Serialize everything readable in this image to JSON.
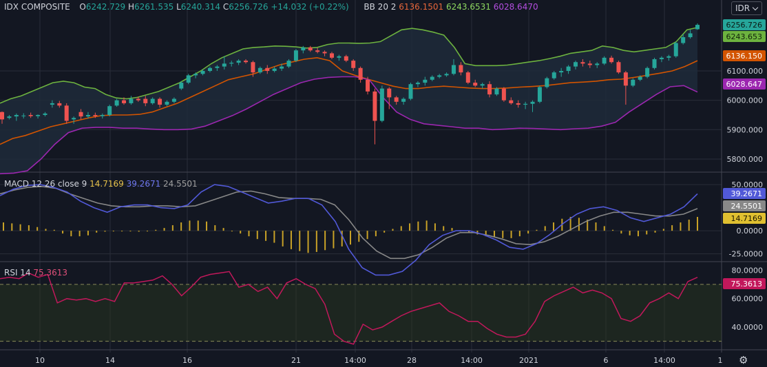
{
  "instrument": {
    "name": "IDX COMPOSITE",
    "open_label": "O",
    "open": "6242.729",
    "high_label": "H",
    "high": "6261.535",
    "low_label": "L",
    "low": "6240.314",
    "close_label": "C",
    "close": "6256.726",
    "change": "+14.032 (+0.22%)"
  },
  "bb_legend": {
    "label": "BB 20 2",
    "basis": "6136.1501",
    "upper": "6243.6531",
    "lower": "6028.6470"
  },
  "macd_legend": {
    "label": "MACD 12 26 close 9",
    "hist": "14.7169",
    "macd": "39.2671",
    "signal": "24.5501"
  },
  "rsi_legend": {
    "label": "RSI 14",
    "value": "75.3613"
  },
  "currency_button": {
    "label": "IDR",
    "icon": "chevron-down-icon"
  },
  "settings_icon": "gear-icon",
  "colors": {
    "background": "#131722",
    "grid": "#2a2e39",
    "up": "#26a69a",
    "down": "#ef5350",
    "bb_upper": "#6db33f",
    "bb_basis": "#d35400",
    "bb_lower": "#9c27b0",
    "macd": "#5159d8",
    "signal": "#888888",
    "hist": "#c9a227",
    "rsi": "#c2185b"
  },
  "badges": {
    "price_close": "6256.726",
    "price_upper": "6243.653",
    "price_basis": "6136.150",
    "price_lower": "6028.647",
    "macd": "39.2671",
    "signal": "24.5501",
    "hist": "14.7169",
    "rsi": "75.3613"
  },
  "price_scale": [
    "6100.000",
    "6000.000",
    "5900.000",
    "5800.000"
  ],
  "macd_scale": [
    "50.0000",
    "0.0000",
    "-25.0000"
  ],
  "rsi_scale": [
    "80.0000",
    "60.0000",
    "40.0000"
  ],
  "time_axis": [
    "10",
    "14",
    "16",
    "21",
    "14:00",
    "28",
    "14:00",
    "2021",
    "6",
    "14:00",
    "1"
  ],
  "chart_data": [
    {
      "type": "candlestick",
      "title": "IDX COMPOSITE",
      "ylim": [
        5760,
        6290
      ],
      "candles": [
        [
          5960,
          5962,
          5920,
          5935
        ],
        [
          5940,
          5950,
          5935,
          5945
        ],
        [
          5945,
          5955,
          5930,
          5950
        ],
        [
          5948,
          5956,
          5938,
          5948
        ],
        [
          5950,
          5958,
          5940,
          5946
        ],
        [
          5946,
          5952,
          5938,
          5950
        ],
        [
          5950,
          5960,
          5945,
          5955
        ],
        [
          5985,
          6000,
          5975,
          5990
        ],
        [
          5990,
          5998,
          5975,
          5982
        ],
        [
          5982,
          5990,
          5920,
          5930
        ],
        [
          5935,
          5945,
          5920,
          5940
        ],
        [
          5960,
          5970,
          5935,
          5945
        ],
        [
          5945,
          5960,
          5938,
          5950
        ],
        [
          5950,
          5958,
          5940,
          5946
        ],
        [
          5946,
          5955,
          5938,
          5950
        ],
        [
          5950,
          5985,
          5945,
          5980
        ],
        [
          5982,
          6005,
          5978,
          6000
        ],
        [
          6000,
          6010,
          5985,
          5990
        ],
        [
          5990,
          6015,
          5985,
          6005
        ],
        [
          6005,
          6012,
          5995,
          6000
        ],
        [
          6005,
          6015,
          5980,
          5990
        ],
        [
          5990,
          6010,
          5985,
          6005
        ],
        [
          6005,
          6010,
          5975,
          5985
        ],
        [
          5985,
          6000,
          5980,
          5995
        ],
        [
          5995,
          6010,
          5990,
          6005
        ],
        [
          6040,
          6065,
          6035,
          6060
        ],
        [
          6060,
          6090,
          6055,
          6085
        ],
        [
          6085,
          6095,
          6075,
          6090
        ],
        [
          6090,
          6105,
          6085,
          6100
        ],
        [
          6100,
          6115,
          6095,
          6110
        ],
        [
          6110,
          6120,
          6100,
          6115
        ],
        [
          6115,
          6150,
          6105,
          6125
        ],
        [
          6125,
          6135,
          6115,
          6128
        ],
        [
          6128,
          6140,
          6120,
          6135
        ],
        [
          6135,
          6140,
          6125,
          6130
        ],
        [
          6130,
          6135,
          6080,
          6095
        ],
        [
          6095,
          6115,
          6090,
          6110
        ],
        [
          6110,
          6120,
          6090,
          6100
        ],
        [
          6100,
          6115,
          6095,
          6108
        ],
        [
          6108,
          6125,
          6100,
          6115
        ],
        [
          6115,
          6140,
          6110,
          6135
        ],
        [
          6135,
          6175,
          6130,
          6170
        ],
        [
          6170,
          6185,
          6160,
          6180
        ],
        [
          6180,
          6185,
          6165,
          6170
        ],
        [
          6170,
          6178,
          6160,
          6165
        ],
        [
          6165,
          6170,
          6150,
          6160
        ],
        [
          6160,
          6165,
          6140,
          6145
        ],
        [
          6145,
          6155,
          6135,
          6150
        ],
        [
          6150,
          6155,
          6130,
          6135
        ],
        [
          6135,
          6140,
          6100,
          6110
        ],
        [
          6110,
          6115,
          6060,
          6070
        ],
        [
          6070,
          6080,
          6020,
          6030
        ],
        [
          6030,
          6040,
          5850,
          5930
        ],
        [
          5930,
          6050,
          5925,
          6040
        ],
        [
          6040,
          6045,
          5970,
          6010
        ],
        [
          6010,
          6015,
          5985,
          5995
        ],
        [
          5995,
          6010,
          5985,
          6005
        ],
        [
          6005,
          6060,
          6000,
          6055
        ],
        [
          6055,
          6065,
          6045,
          6060
        ],
        [
          6060,
          6080,
          6050,
          6070
        ],
        [
          6070,
          6085,
          6065,
          6080
        ],
        [
          6080,
          6090,
          6075,
          6085
        ],
        [
          6085,
          6095,
          6080,
          6090
        ],
        [
          6090,
          6140,
          6085,
          6120
        ],
        [
          6120,
          6130,
          6085,
          6095
        ],
        [
          6095,
          6100,
          6055,
          6060
        ],
        [
          6060,
          6070,
          6045,
          6050
        ],
        [
          6050,
          6060,
          6040,
          6055
        ],
        [
          6055,
          6065,
          6010,
          6020
        ],
        [
          6020,
          6045,
          6015,
          6040
        ],
        [
          6040,
          6045,
          5995,
          6000
        ],
        [
          6000,
          6010,
          5985,
          5990
        ],
        [
          5990,
          6000,
          5975,
          5985
        ],
        [
          5985,
          5995,
          5970,
          5988
        ],
        [
          5988,
          6000,
          5960,
          5995
        ],
        [
          5995,
          6050,
          5990,
          6045
        ],
        [
          6045,
          6080,
          6040,
          6075
        ],
        [
          6075,
          6100,
          6070,
          6095
        ],
        [
          6095,
          6110,
          6080,
          6100
        ],
        [
          6100,
          6120,
          6090,
          6115
        ],
        [
          6115,
          6135,
          6105,
          6130
        ],
        [
          6130,
          6140,
          6115,
          6125
        ],
        [
          6125,
          6135,
          6110,
          6120
        ],
        [
          6120,
          6130,
          6110,
          6125
        ],
        [
          6125,
          6150,
          6120,
          6145
        ],
        [
          6145,
          6152,
          6125,
          6130
        ],
        [
          6130,
          6135,
          6090,
          6095
        ],
        [
          6095,
          6100,
          5985,
          6050
        ],
        [
          6050,
          6075,
          6045,
          6070
        ],
        [
          6070,
          6085,
          6065,
          6080
        ],
        [
          6080,
          6115,
          6075,
          6110
        ],
        [
          6110,
          6145,
          6105,
          6140
        ],
        [
          6140,
          6150,
          6130,
          6145
        ],
        [
          6145,
          6155,
          6135,
          6150
        ],
        [
          6150,
          6200,
          6145,
          6195
        ],
        [
          6195,
          6225,
          6190,
          6215
        ],
        [
          6215,
          6240,
          6210,
          6228
        ],
        [
          6242,
          6262,
          6240,
          6257
        ]
      ],
      "bb_upper": [
        5990,
        6005,
        6015,
        6030,
        6045,
        6060,
        6065,
        6060,
        6045,
        6040,
        6020,
        6008,
        6005,
        6010,
        6020,
        6030,
        6045,
        6060,
        6080,
        6100,
        6125,
        6145,
        6160,
        6175,
        6180,
        6182,
        6185,
        6184,
        6182,
        6178,
        6180,
        6190,
        6195,
        6195,
        6194,
        6195,
        6200,
        6220,
        6240,
        6245,
        6240,
        6232,
        6222,
        6180,
        6125,
        6118,
        6118,
        6118,
        6120,
        6125,
        6130,
        6135,
        6142,
        6150,
        6160,
        6165,
        6170,
        6185,
        6180,
        6170,
        6165,
        6170,
        6175,
        6180,
        6200,
        6240,
        6248
      ],
      "bb_basis": [
        5850,
        5870,
        5880,
        5895,
        5910,
        5920,
        5930,
        5940,
        5948,
        5950,
        5950,
        5952,
        5960,
        5975,
        5990,
        6010,
        6030,
        6050,
        6070,
        6080,
        6090,
        6105,
        6120,
        6130,
        6140,
        6145,
        6135,
        6100,
        6085,
        6072,
        6060,
        6048,
        6040,
        6040,
        6045,
        6048,
        6045,
        6042,
        6040,
        6040,
        6042,
        6045,
        6047,
        6050,
        6055,
        6060,
        6062,
        6065,
        6070,
        6072,
        6078,
        6085,
        6092,
        6100,
        6115,
        6135
      ],
      "bb_lower": [
        5750,
        5752,
        5760,
        5800,
        5850,
        5890,
        5905,
        5908,
        5908,
        5905,
        5905,
        5902,
        5900,
        5900,
        5902,
        5912,
        5930,
        5948,
        5970,
        5995,
        6020,
        6040,
        6060,
        6072,
        6078,
        6080,
        6080,
        6070,
        6010,
        5960,
        5935,
        5920,
        5915,
        5910,
        5905,
        5905,
        5900,
        5902,
        5905,
        5904,
        5902,
        5900,
        5903,
        5905,
        5912,
        5925,
        5960,
        5990,
        6020,
        6046,
        6050,
        6028
      ],
      "xlabels": [
        "10",
        "14",
        "16",
        "21",
        "14:00",
        "28",
        "14:00",
        "2021",
        "6",
        "14:00",
        "1"
      ]
    },
    {
      "type": "line",
      "title": "MACD 12 26 close 9",
      "ylim": [
        -32,
        62
      ],
      "series": [
        {
          "name": "macd",
          "values": [
            38,
            45,
            49,
            50,
            47,
            42,
            32,
            25,
            20,
            26,
            28,
            28,
            25,
            24,
            28,
            42,
            50,
            48,
            42,
            36,
            30,
            32,
            35,
            35,
            28,
            10,
            -20,
            -40,
            -48,
            -48,
            -44,
            -32,
            -15,
            -5,
            0,
            0,
            -4,
            -10,
            -18,
            -20,
            -14,
            -4,
            8,
            18,
            24,
            26,
            22,
            14,
            10,
            14,
            18,
            26,
            40
          ]
        },
        {
          "name": "signal",
          "values": [
            40,
            44,
            47,
            48,
            46,
            40,
            35,
            30,
            27,
            26,
            26,
            27,
            27,
            26,
            27,
            32,
            37,
            42,
            43,
            40,
            36,
            35,
            35,
            34,
            28,
            12,
            -8,
            -22,
            -30,
            -30,
            -26,
            -18,
            -8,
            -2,
            -2,
            -5,
            -9,
            -14,
            -15,
            -12,
            -6,
            2,
            10,
            16,
            20,
            20,
            18,
            16,
            16,
            18,
            24
          ]
        }
      ],
      "hist": [
        9,
        8,
        7,
        6,
        4,
        2,
        1,
        -3,
        -6,
        -6,
        -5,
        -2,
        -1,
        0,
        0,
        0,
        -1,
        0,
        1,
        3,
        6,
        9,
        11,
        11,
        10,
        6,
        3,
        0,
        -3,
        -6,
        -9,
        -11,
        -13,
        -17,
        -20,
        -22,
        -24,
        -23,
        -21,
        -19,
        -17,
        -15,
        -12,
        -9,
        -6,
        -2,
        2,
        5,
        8,
        10,
        11,
        8,
        5,
        3,
        0,
        -2,
        -4,
        -6,
        -7,
        -8,
        -8,
        -6,
        -3,
        1,
        5,
        9,
        13,
        15,
        14,
        12,
        9,
        5,
        1,
        -3,
        -5,
        -6,
        -4,
        -2,
        2,
        6,
        9,
        12,
        15
      ]
    },
    {
      "type": "line",
      "title": "RSI 14",
      "ylim": [
        25,
        85
      ],
      "series": [
        {
          "name": "rsi",
          "values": [
            74,
            75,
            74,
            78,
            75,
            77,
            57,
            60,
            59,
            60,
            58,
            60,
            58,
            71,
            71,
            72,
            73,
            76,
            70,
            62,
            68,
            75,
            77,
            78,
            79,
            68,
            70,
            65,
            68,
            60,
            71,
            74,
            70,
            67,
            56,
            35,
            30,
            28,
            42,
            38,
            40,
            44,
            48,
            51,
            53,
            55,
            57,
            51,
            48,
            44,
            44,
            39,
            35,
            33,
            33,
            35,
            44,
            58,
            62,
            65,
            68,
            64,
            66,
            64,
            60,
            46,
            44,
            48,
            57,
            60,
            64,
            60,
            72,
            75
          ]
        }
      ],
      "levels": [
        70,
        30
      ]
    }
  ]
}
